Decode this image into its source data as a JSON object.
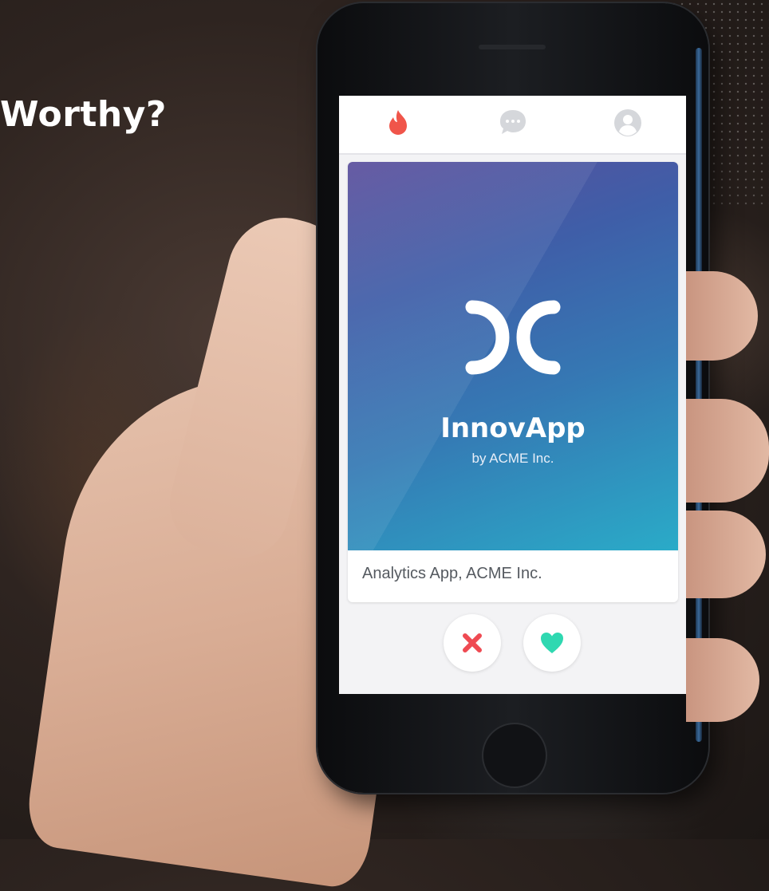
{
  "headline": "Worthy?",
  "nav": {
    "icons": [
      "flame-icon",
      "chat-icon",
      "profile-icon"
    ]
  },
  "card": {
    "app_name": "InnovApp",
    "byline": "by ACME Inc.",
    "caption": "Analytics App, ACME Inc."
  },
  "actions": {
    "nope_icon": "close-icon",
    "like_icon": "heart-icon"
  },
  "colors": {
    "flame": "#f0554a",
    "nope": "#ef4a52",
    "like": "#2fd8b1",
    "gradient_start": "#5b4f9c",
    "gradient_end": "#2aabc8"
  }
}
